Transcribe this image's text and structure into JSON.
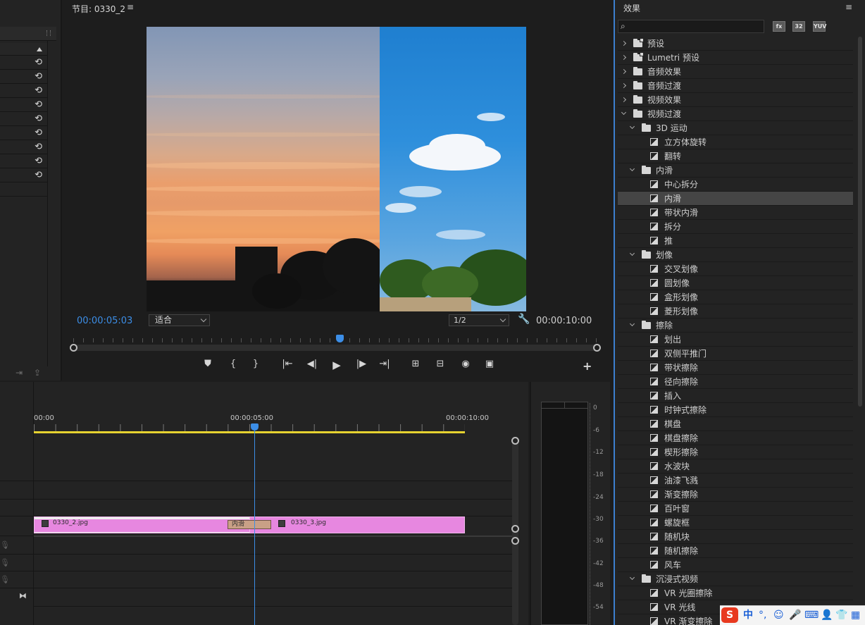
{
  "program": {
    "title": "节目: 0330_2",
    "menu_icon": "≡",
    "current_time": "00:00:05:03",
    "fit_label": "适合",
    "resolution": "1/2",
    "duration": "00:00:10:00",
    "transport": [
      "marker-icon",
      "mark-in-icon",
      "mark-out-icon",
      "go-to-in-icon",
      "step-back-icon",
      "play-icon",
      "step-forward-icon",
      "go-to-out-icon",
      "lift-icon",
      "extract-icon",
      "export-frame-icon",
      "comparison-view-icon"
    ],
    "add_icon": "+"
  },
  "timeline": {
    "ruler": [
      "00:00",
      "00:00:05:00",
      "00:00:10:00"
    ],
    "clip_a": "0330_2.jpg",
    "clip_b": "0330_3.jpg",
    "transition": "内滑"
  },
  "meter": {
    "db_scale": [
      "0",
      "-6",
      "-12",
      "-18",
      "-24",
      "-30",
      "-36",
      "-42",
      "-48",
      "-54"
    ]
  },
  "effects": {
    "title": "效果",
    "menu_icon": "≡",
    "badges": [
      "fx",
      "32",
      "YUV"
    ],
    "items": [
      {
        "label": "预设",
        "level": 0,
        "kind": "preset",
        "expanded": false
      },
      {
        "label": "Lumetri 预设",
        "level": 0,
        "kind": "preset",
        "expanded": false
      },
      {
        "label": "音频效果",
        "level": 0,
        "kind": "folder",
        "expanded": false
      },
      {
        "label": "音频过渡",
        "level": 0,
        "kind": "folder",
        "expanded": false
      },
      {
        "label": "视频效果",
        "level": 0,
        "kind": "folder",
        "expanded": false
      },
      {
        "label": "视频过渡",
        "level": 0,
        "kind": "folder",
        "expanded": true
      },
      {
        "label": "3D 运动",
        "level": 1,
        "kind": "folder",
        "expanded": true
      },
      {
        "label": "立方体旋转",
        "level": 2,
        "kind": "effect"
      },
      {
        "label": "翻转",
        "level": 2,
        "kind": "effect"
      },
      {
        "label": "内滑",
        "level": 1,
        "kind": "folder",
        "expanded": true
      },
      {
        "label": "中心拆分",
        "level": 2,
        "kind": "effect"
      },
      {
        "label": "内滑",
        "level": 2,
        "kind": "effect",
        "selected": true
      },
      {
        "label": "带状内滑",
        "level": 2,
        "kind": "effect"
      },
      {
        "label": "拆分",
        "level": 2,
        "kind": "effect"
      },
      {
        "label": "推",
        "level": 2,
        "kind": "effect"
      },
      {
        "label": "划像",
        "level": 1,
        "kind": "folder",
        "expanded": true
      },
      {
        "label": "交叉划像",
        "level": 2,
        "kind": "effect"
      },
      {
        "label": "圆划像",
        "level": 2,
        "kind": "effect"
      },
      {
        "label": "盒形划像",
        "level": 2,
        "kind": "effect"
      },
      {
        "label": "菱形划像",
        "level": 2,
        "kind": "effect"
      },
      {
        "label": "擦除",
        "level": 1,
        "kind": "folder",
        "expanded": true
      },
      {
        "label": "划出",
        "level": 2,
        "kind": "effect"
      },
      {
        "label": "双侧平推门",
        "level": 2,
        "kind": "effect"
      },
      {
        "label": "带状擦除",
        "level": 2,
        "kind": "effect"
      },
      {
        "label": "径向擦除",
        "level": 2,
        "kind": "effect"
      },
      {
        "label": "插入",
        "level": 2,
        "kind": "effect"
      },
      {
        "label": "时钟式擦除",
        "level": 2,
        "kind": "effect"
      },
      {
        "label": "棋盘",
        "level": 2,
        "kind": "effect"
      },
      {
        "label": "棋盘擦除",
        "level": 2,
        "kind": "effect"
      },
      {
        "label": "楔形擦除",
        "level": 2,
        "kind": "effect"
      },
      {
        "label": "水波块",
        "level": 2,
        "kind": "effect"
      },
      {
        "label": "油漆飞溅",
        "level": 2,
        "kind": "effect"
      },
      {
        "label": "渐变擦除",
        "level": 2,
        "kind": "effect"
      },
      {
        "label": "百叶窗",
        "level": 2,
        "kind": "effect"
      },
      {
        "label": "螺旋框",
        "level": 2,
        "kind": "effect"
      },
      {
        "label": "随机块",
        "level": 2,
        "kind": "effect"
      },
      {
        "label": "随机擦除",
        "level": 2,
        "kind": "effect"
      },
      {
        "label": "风车",
        "level": 2,
        "kind": "effect"
      },
      {
        "label": "沉浸式视频",
        "level": 1,
        "kind": "folder",
        "expanded": true
      },
      {
        "label": "VR 光圈擦除",
        "level": 2,
        "kind": "effect"
      },
      {
        "label": "VR 光线",
        "level": 2,
        "kind": "effect"
      },
      {
        "label": "VR 渐变擦除",
        "level": 2,
        "kind": "effect"
      }
    ]
  },
  "ime": {
    "logo": "S",
    "items": [
      "中",
      "°,",
      "☺",
      "🎤",
      "⌨",
      "👤",
      "👕",
      "▦"
    ]
  }
}
